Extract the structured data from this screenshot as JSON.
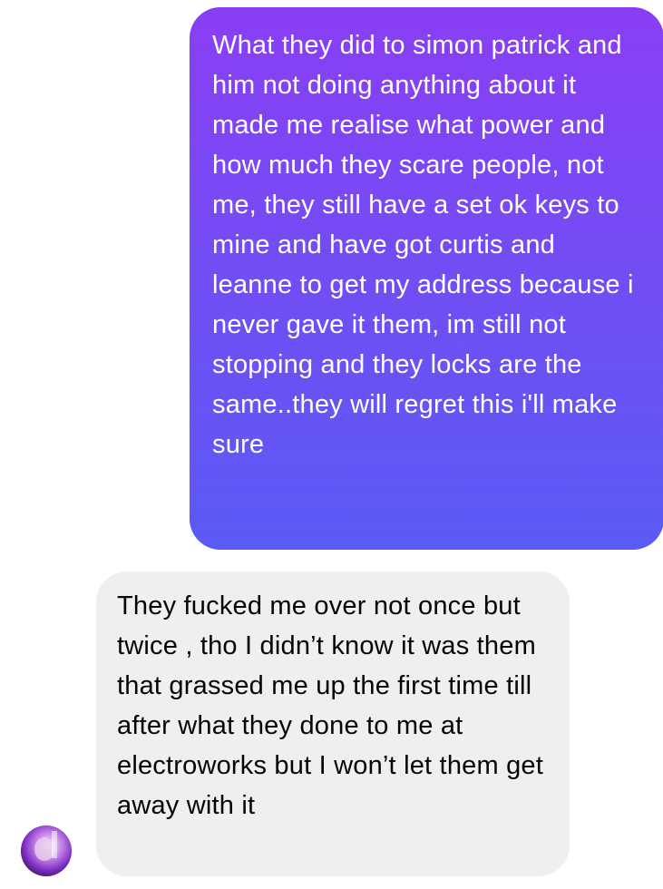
{
  "conversation": {
    "messages": [
      {
        "direction": "sent",
        "text": "What they did to simon patrick and him not doing anything about it made me realise what power and how much they scare people, not me, they still have a set ok keys to mine and have got curtis and leanne to get my address because i never gave it them, im still not stopping and they locks are the same..they will regret this i'll make sure"
      },
      {
        "direction": "received",
        "text": "They fucked me over not once but twice , tho I didn’t know it was them that grassed me up the first time till after what they done to me at electroworks but I won’t let them get away with it"
      }
    ],
    "colors": {
      "sent_bubble_top": "#8a3ef4",
      "sent_bubble_bottom": "#5a5af5",
      "received_bubble": "#efefef",
      "sent_text": "#ffffff",
      "received_text": "#050505"
    },
    "avatar_icon": "contact-avatar"
  }
}
